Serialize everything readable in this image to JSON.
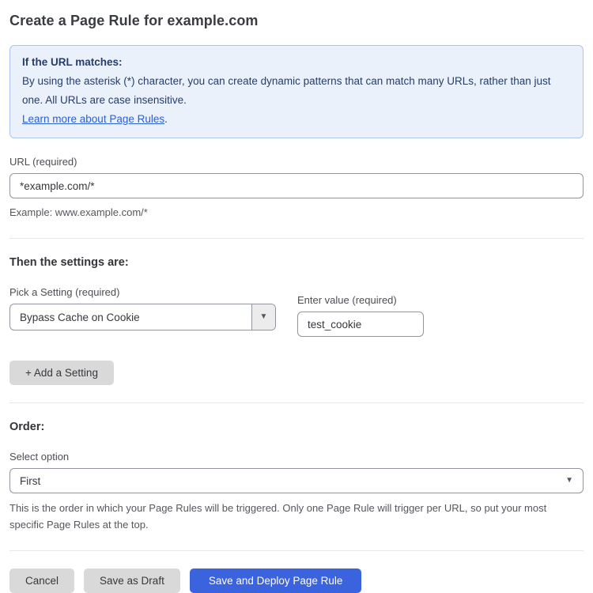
{
  "page": {
    "title": "Create a Page Rule for example.com"
  },
  "info_box": {
    "heading": "If the URL matches:",
    "body": "By using the asterisk (*) character, you can create dynamic patterns that can match many URLs, rather than just one. All URLs are case insensitive.",
    "link_label": "Learn more about Page Rules",
    "link_suffix": "."
  },
  "url_section": {
    "label": "URL (required)",
    "value": "*example.com/*",
    "example": "Example: www.example.com/*"
  },
  "settings_section": {
    "heading": "Then the settings are:",
    "setting_label": "Pick a Setting (required)",
    "setting_value": "Bypass Cache on Cookie",
    "value_label": "Enter value (required)",
    "value_value": "test_cookie",
    "add_button_label": "+ Add a Setting",
    "caret": "▼"
  },
  "order_section": {
    "heading": "Order:",
    "select_label": "Select option",
    "select_value": "First",
    "caret": "▼",
    "help_text": "This is the order in which your Page Rules will be triggered. Only one Page Rule will trigger per URL, so put your most specific Page Rules at the top."
  },
  "actions": {
    "cancel_label": "Cancel",
    "save_draft_label": "Save as Draft",
    "save_deploy_label": "Save and Deploy Page Rule"
  },
  "colors": {
    "info_bg": "#eaf1fb",
    "info_border": "#abc7ee",
    "info_text": "#263d6a",
    "link_blue": "#2c5fd0",
    "primary_blue": "#3b63dd",
    "button_grey": "#d9d9d9",
    "input_border": "#92959b"
  }
}
